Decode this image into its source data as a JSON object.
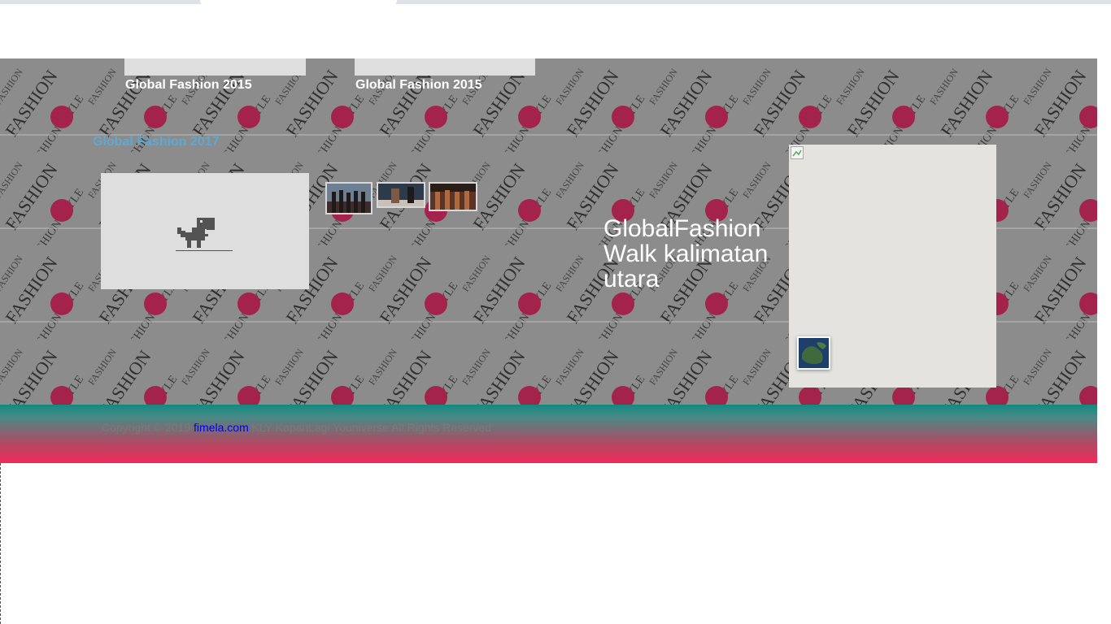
{
  "featured_cards": [
    {
      "caption": "Global Fashion 2015"
    },
    {
      "caption": "Global Fashion 2015"
    }
  ],
  "section": {
    "title": "Global Fashion 2017"
  },
  "headline": "GlobalFashion Walk kalimatan utara",
  "footer": {
    "copyright_prefix": "Copyright © 2019 ",
    "link_text": "fimela.com",
    "copyright_suffix": " KLY KapanLagi Youniverse All Rights Reserved"
  },
  "colors": {
    "caption_text": "#ffffff",
    "section_title": "#5da9d6",
    "footer_top": "#128a7f",
    "footer_bottom": "#f02a5b",
    "badge": "#a3234c"
  },
  "icons": [
    "offline-dino-icon",
    "broken-image-icon",
    "map-satellite-icon"
  ]
}
